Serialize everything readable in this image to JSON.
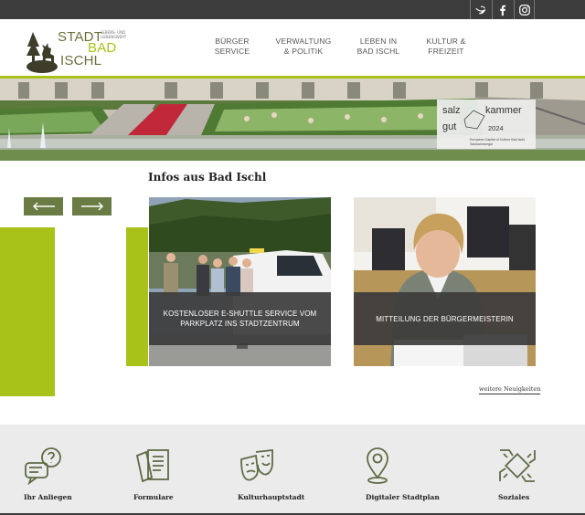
{
  "social": {
    "items": [
      {
        "icon": "bird-icon"
      },
      {
        "icon": "facebook-icon"
      },
      {
        "icon": "instagram-icon"
      }
    ]
  },
  "header": {
    "logo": {
      "line1": "STADT",
      "line2": "BAD",
      "line3": "ISCHL",
      "tagline": "LEBENS- UND LIEBENSWERT"
    },
    "nav": [
      {
        "line1": "BÜRGER",
        "line2": "SERVICE"
      },
      {
        "line1": "VERWALTUNG",
        "line2": "& POLITIK"
      },
      {
        "line1": "LEBEN IN",
        "line2": "BAD ISCHL"
      },
      {
        "line1": "KULTUR &",
        "line2": "FREIZEIT"
      }
    ],
    "accent_color": "#a9c21a"
  },
  "hero": {
    "badge": {
      "word1": "salz",
      "word2": "kammer",
      "word3": "gut",
      "year": "2024",
      "caption": "European Capital of Culture Bad Ischl Salzkammergut"
    }
  },
  "news": {
    "title": "Infos aus Bad Ischl",
    "cards": [
      {
        "label": "KOSTENLOSER E-SHUTTLE SERVICE VOM PARKPLATZ INS STADTZENTRUM"
      },
      {
        "label": "MITTEILUNG DER BÜRGERMEISTERIN"
      }
    ],
    "more_link": "weitere Neuigkeiten"
  },
  "services": {
    "items": [
      {
        "label": "Ihr Anliegen",
        "icon": "speech-bubbles-icon"
      },
      {
        "label": "Formulare",
        "icon": "documents-icon"
      },
      {
        "label": "Kulturhauptstadt",
        "icon": "theater-masks-icon"
      },
      {
        "label": "Digitaler Stadtplan",
        "icon": "map-pin-icon"
      },
      {
        "label": "Soziales",
        "icon": "joined-hands-icon"
      }
    ],
    "icon_color": "#5e6b45"
  }
}
